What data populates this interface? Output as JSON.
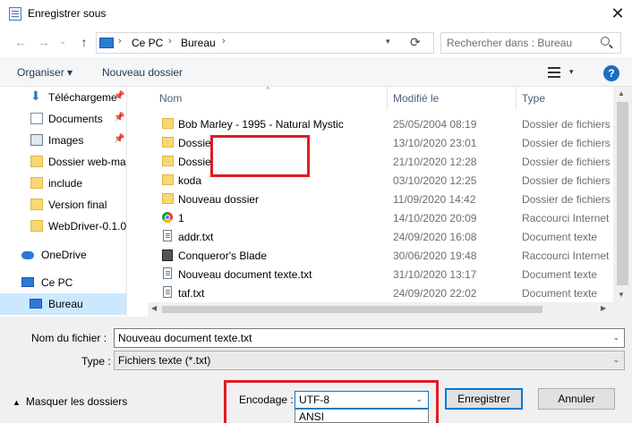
{
  "window": {
    "title": "Enregistrer sous",
    "close_glyph": "✕"
  },
  "nav": {
    "back_glyph": "←",
    "forward_glyph": "→",
    "recent_glyph": "⌄",
    "up_glyph": "↑",
    "breadcrumb": [
      "Ce PC",
      "Bureau"
    ],
    "separator_glyph": "›",
    "search_placeholder": "Rechercher dans : Bureau"
  },
  "toolbar": {
    "organize_label": "Organiser ▾",
    "new_folder_label": "Nouveau dossier",
    "view_drop_glyph": "▾",
    "help_label": "?"
  },
  "sidebar": {
    "pin_glyph": "📌",
    "items": [
      {
        "label": "Téléchargeme",
        "icon": "download-icon",
        "pinned": true
      },
      {
        "label": "Documents",
        "icon": "document-icon",
        "pinned": true
      },
      {
        "label": "Images",
        "icon": "image-icon",
        "pinned": true
      },
      {
        "label": "Dossier web-ma",
        "icon": "folder-icon"
      },
      {
        "label": "include",
        "icon": "folder-icon"
      },
      {
        "label": "Version final",
        "icon": "folder-icon"
      },
      {
        "label": "WebDriver-0.1.0.",
        "icon": "folder-icon"
      },
      {
        "label": "OneDrive",
        "icon": "onedrive-icon"
      },
      {
        "label": "Ce PC",
        "icon": "computer-icon"
      },
      {
        "label": "Bureau",
        "icon": "desktop-icon",
        "selected": true
      }
    ]
  },
  "files": {
    "sort_glyph": "^",
    "columns": {
      "name": "Nom",
      "modified": "Modifié le",
      "type": "Type"
    },
    "rows": [
      {
        "name": "Bob Marley - 1995 - Natural Mystic",
        "modified": "25/05/2004 08:19",
        "type": "Dossier de fichiers",
        "icon": "folder"
      },
      {
        "name": "Dossier",
        "modified": "13/10/2020 23:01",
        "type": "Dossier de fichiers",
        "icon": "folder"
      },
      {
        "name": "Dossier",
        "modified": "21/10/2020 12:28",
        "type": "Dossier de fichiers",
        "icon": "folder"
      },
      {
        "name": "koda",
        "modified": "03/10/2020 12:25",
        "type": "Dossier de fichiers",
        "icon": "folder"
      },
      {
        "name": "Nouveau dossier",
        "modified": "11/09/2020 14:42",
        "type": "Dossier de fichiers",
        "icon": "folder"
      },
      {
        "name": "1",
        "modified": "14/10/2020 20:09",
        "type": "Raccourci Internet",
        "icon": "chrome"
      },
      {
        "name": "addr.txt",
        "modified": "24/09/2020 16:08",
        "type": "Document texte",
        "icon": "txt"
      },
      {
        "name": "Conqueror's Blade",
        "modified": "30/06/2020 19:48",
        "type": "Raccourci Internet",
        "icon": "game"
      },
      {
        "name": "Nouveau document texte.txt",
        "modified": "31/10/2020 13:17",
        "type": "Document texte",
        "icon": "txt"
      },
      {
        "name": "taf.txt",
        "modified": "24/09/2020 22:02",
        "type": "Document texte",
        "icon": "txt"
      }
    ]
  },
  "scroll": {
    "up_glyph": "▲",
    "down_glyph": "▼",
    "left_glyph": "◀",
    "right_glyph": "▶"
  },
  "form": {
    "filename_label": "Nom du fichier :",
    "filename_value": "Nouveau document texte.txt",
    "type_label": "Type :",
    "type_value": "Fichiers texte (*.txt)",
    "caret_glyph": "⌄",
    "encoding_label": "Encodage :",
    "encoding_value": "UTF-8",
    "encoding_option_visible": "ANSI",
    "hide_folders_label": "Masquer les dossiers",
    "hide_folders_glyph": "▲",
    "save_label": "Enregistrer",
    "cancel_label": "Annuler"
  },
  "colors": {
    "highlight_red": "#e01b24",
    "selection_blue": "#cce8ff",
    "accent_blue": "#0078d7"
  }
}
